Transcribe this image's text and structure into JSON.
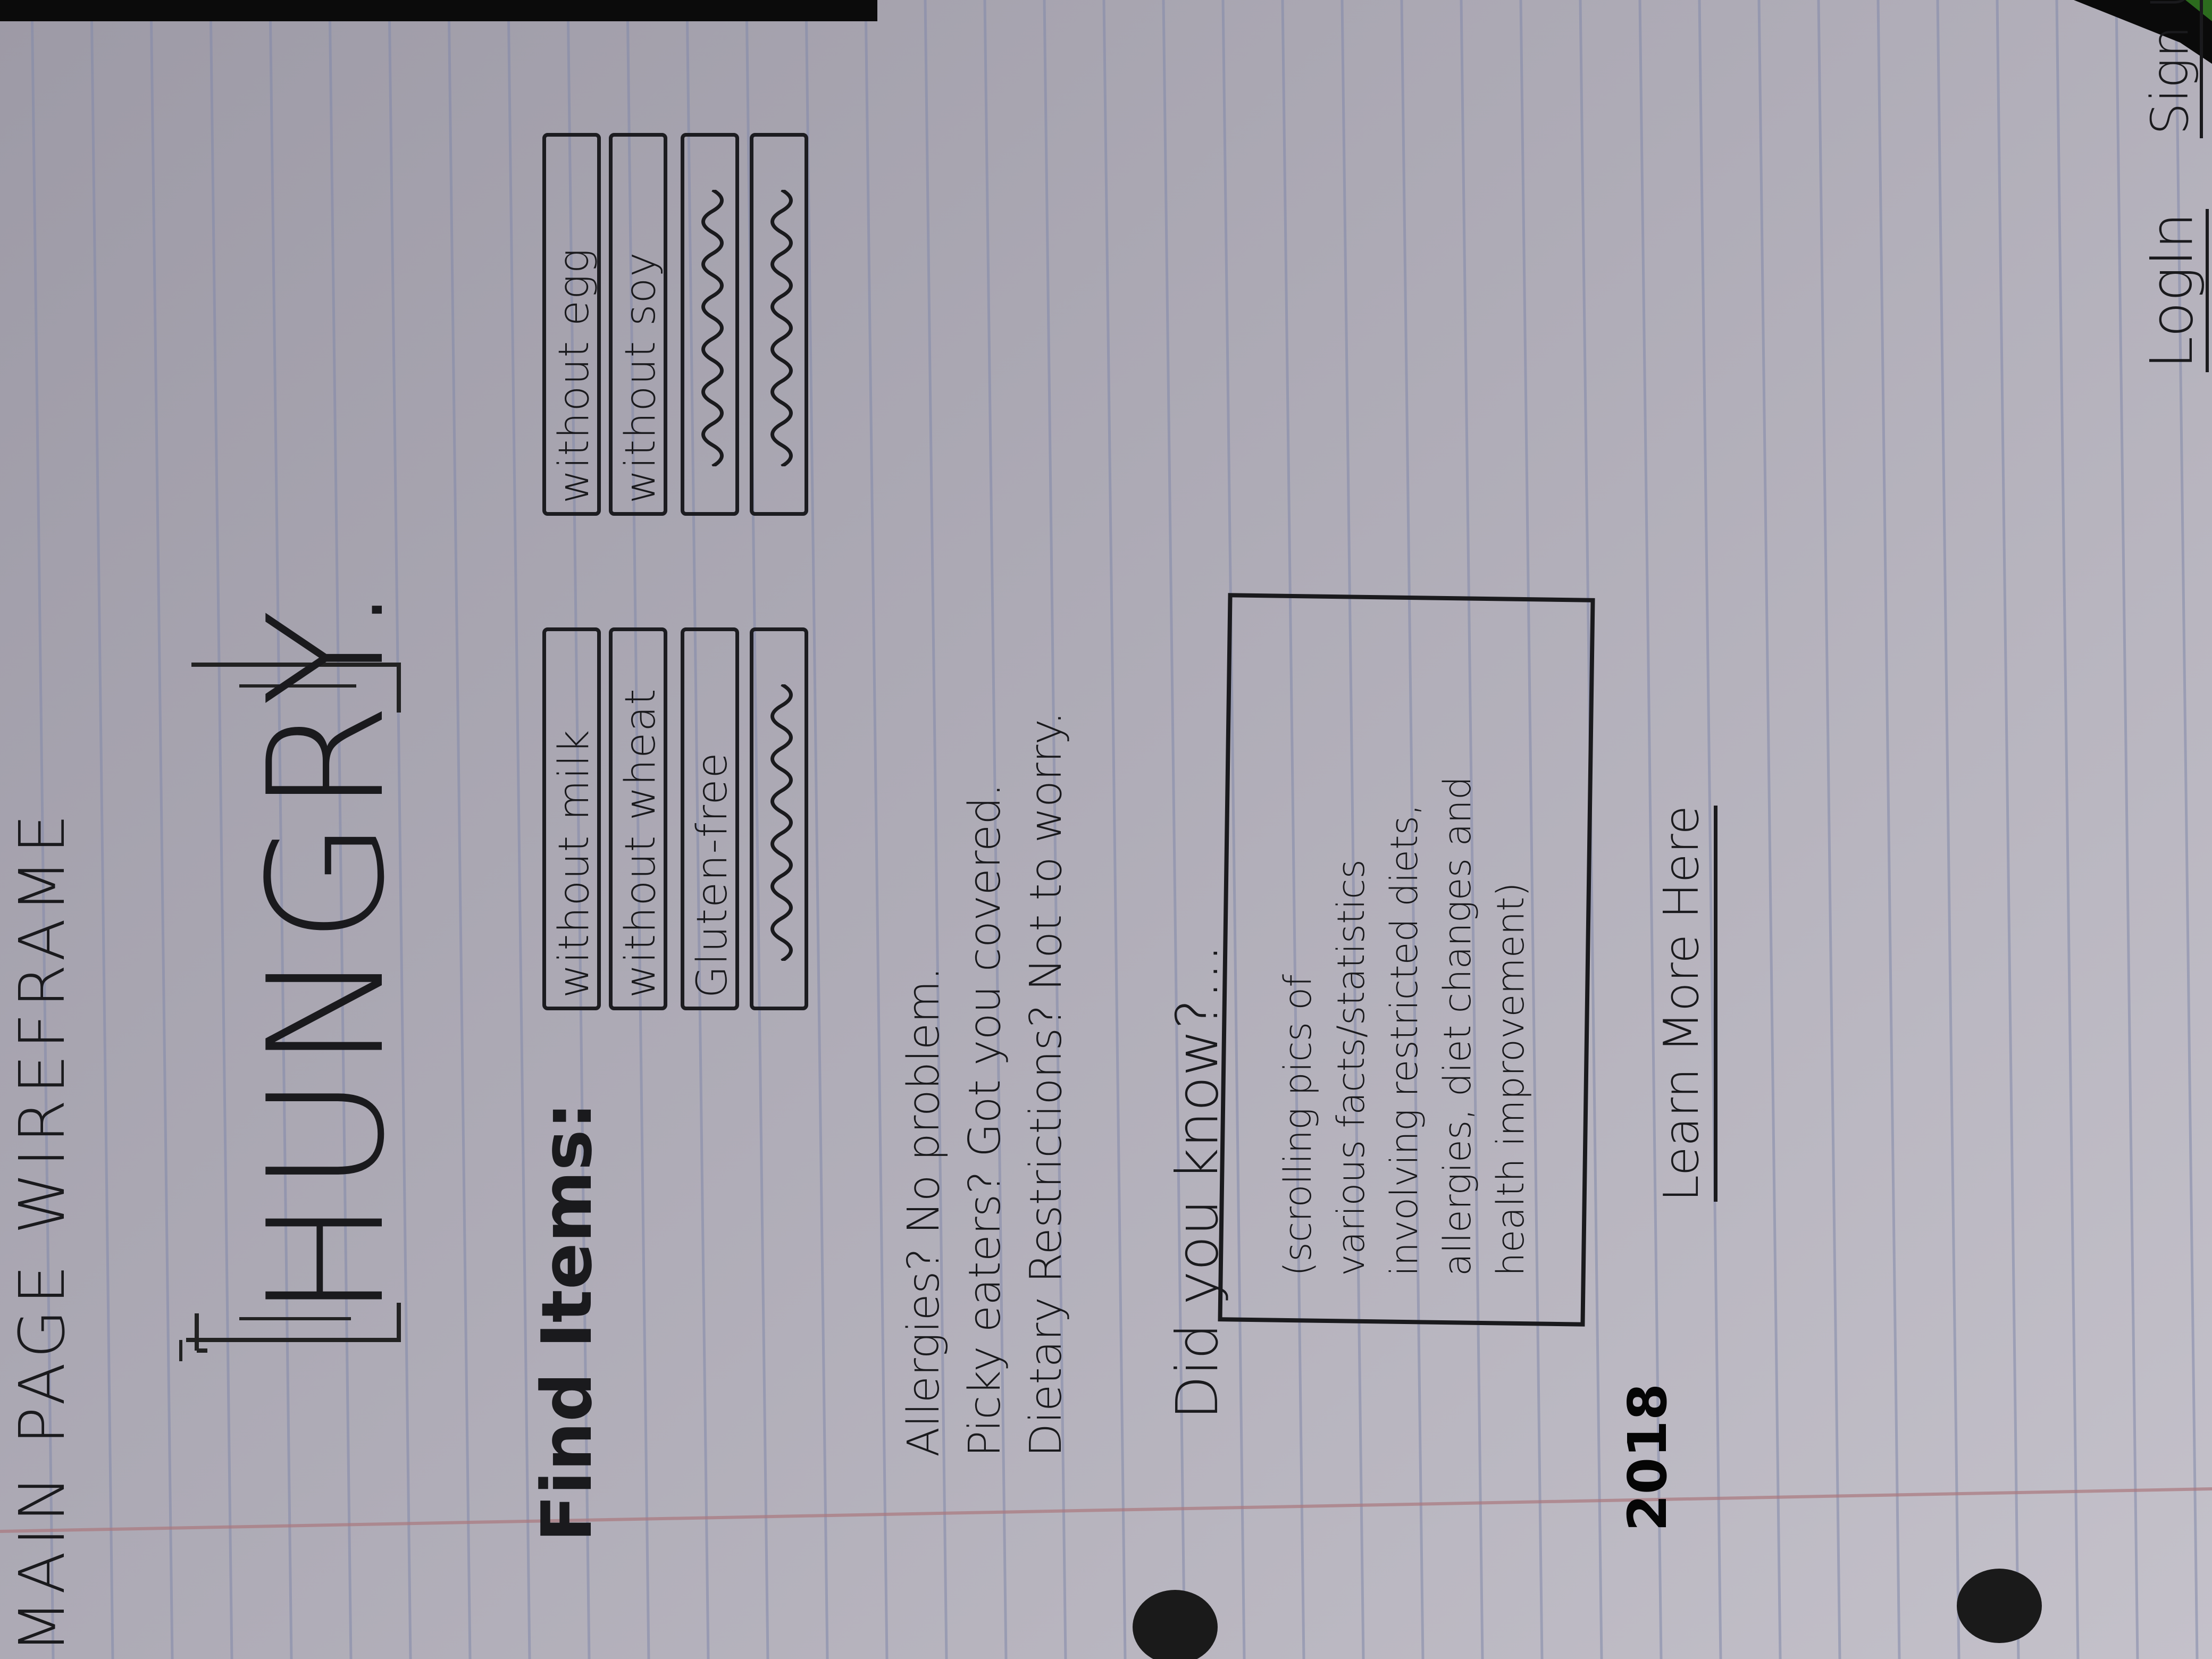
{
  "page_heading": "MAIN PAGE WIREFRAME",
  "nav": {
    "login": "LogIn",
    "signup": "Sign Up"
  },
  "hero": {
    "title": "HUNGRY."
  },
  "find": {
    "label": "Find Items:",
    "filters_col1": [
      "without milk",
      "without wheat",
      "Gluten-free",
      ""
    ],
    "filters_col2": [
      "without egg",
      "without soy",
      "",
      ""
    ]
  },
  "pitch": {
    "lines": [
      "Allergies? No problem.",
      "Picky eaters? Got you covered.",
      "Dietary Restrictions? Not to worry."
    ]
  },
  "did_you_know": {
    "heading": "Did you know?...",
    "box_lines": [
      "(scrolling pics of",
      "various facts/statistics",
      "involving restricted diets,",
      "allergies, diet changes and",
      "health improvement)"
    ]
  },
  "learn_more": "Learn More Here",
  "year": "2018",
  "colors": {
    "ink": "#1a1a1d",
    "paper": "#b3b0ba",
    "rule_blue": "#7f86a8",
    "margin_red": "#a9787d"
  }
}
